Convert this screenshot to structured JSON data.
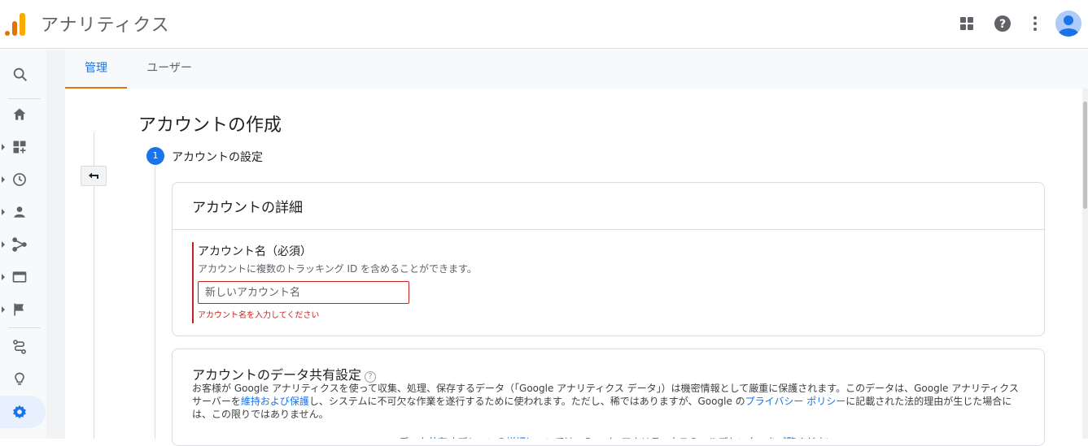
{
  "app": {
    "title": "アナリティクス",
    "brand_colors": {
      "orange_dark": "#e37400",
      "orange": "#f9ab00"
    }
  },
  "topbar": {
    "icons": [
      "apps-grid-icon",
      "help-icon",
      "more-vert-icon",
      "account-avatar"
    ]
  },
  "leftnav": {
    "items": [
      {
        "name": "search-icon",
        "has_caret": false
      },
      {
        "name": "home-icon",
        "has_caret": false
      },
      {
        "name": "customization-icon",
        "has_caret": true
      },
      {
        "name": "realtime-clock-icon",
        "has_caret": true
      },
      {
        "name": "audience-person-icon",
        "has_caret": true
      },
      {
        "name": "acquisition-icon",
        "has_caret": true
      },
      {
        "name": "behavior-icon",
        "has_caret": true
      },
      {
        "name": "conversions-flag-icon",
        "has_caret": true
      },
      {
        "name": "attribution-icon",
        "has_caret": false
      },
      {
        "name": "discover-lightbulb-icon",
        "has_caret": false
      },
      {
        "name": "admin-gear-icon",
        "has_caret": false,
        "active": true
      }
    ]
  },
  "tabs": [
    {
      "label": "管理",
      "active": true
    },
    {
      "label": "ユーザー",
      "active": false
    }
  ],
  "page": {
    "title": "アカウントの作成",
    "step_number": "1",
    "step_label": "アカウントの設定"
  },
  "account_details": {
    "heading": "アカウントの詳細",
    "field_label": "アカウント名（必須）",
    "field_help": "アカウントに複数のトラッキング ID を含めることができます。",
    "placeholder": "新しいアカウント名",
    "error": "アカウント名を入力してください"
  },
  "data_sharing": {
    "heading": "アカウントのデータ共有設定",
    "body_1": "お客様が Google アナリティクスを使って収集、処理、保存するデータ（「Google アナリティクス データ」）は機密情報として厳重に保護されます。このデータは、Google アナリティクス サーバーを",
    "link_1": "維持および保護",
    "body_2": "し、システムに不可欠な作業を遂行するために使われます。ただし、稀ではありますが、Google の",
    "link_2": "プライバシー ポリシー",
    "body_3": "に記載された法的理由が生じた場合には、この限りではありません。"
  },
  "bottom_hint": "データ共有オプションの詳細については、Google アナリティクスのヘルプセンターをご覧ください。"
}
